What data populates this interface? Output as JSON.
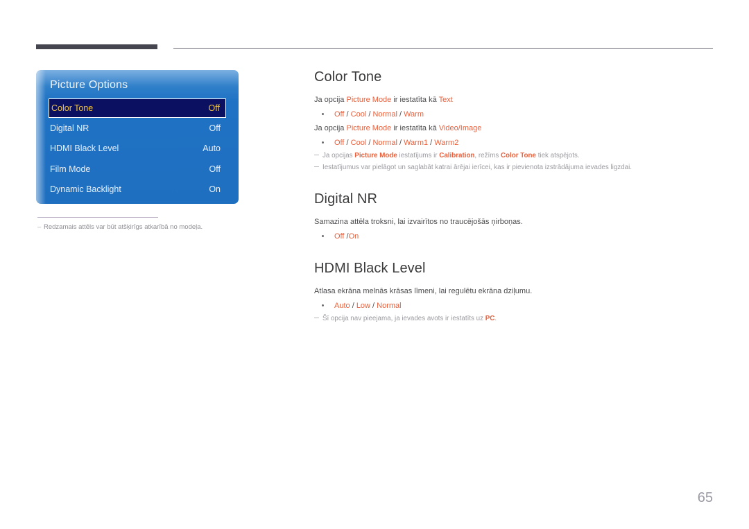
{
  "page": {
    "number": "65",
    "language": "lv"
  },
  "osd": {
    "title": "Picture Options",
    "rows": [
      {
        "label": "Color Tone",
        "value": "Off",
        "selected": true
      },
      {
        "label": "Digital NR",
        "value": "Off",
        "selected": false
      },
      {
        "label": "HDMI Black Level",
        "value": "Auto",
        "selected": false
      },
      {
        "label": "Film Mode",
        "value": "Off",
        "selected": false
      },
      {
        "label": "Dynamic Backlight",
        "value": "On",
        "selected": false
      }
    ],
    "footnote": "Redzamais attēls var būt atšķirīgs atkarībā no modeļa.",
    "footnote_dash": "–"
  },
  "sections": [
    {
      "id": "color-tone",
      "title": "Color Tone",
      "line1": {
        "pre": "Ja opcija ",
        "term": "Picture Mode",
        "mid": " ir iestatīta kā ",
        "mode": "Text"
      },
      "opts1": [
        "Off",
        "Cool",
        "Normal",
        "Warm"
      ],
      "line2": {
        "pre": "Ja opcija ",
        "term": "Picture Mode",
        "mid": " ir iestatīta kā ",
        "mode": "Video/Image"
      },
      "opts2": [
        "Off",
        "Cool",
        "Normal",
        "Warm1",
        "Warm2"
      ],
      "note1": {
        "a": "Ja opcijas ",
        "t1": "Picture Mode",
        "b": " iestatījums ir ",
        "t2": "Calibration",
        "c": ", režīms ",
        "t3": "Color Tone",
        "d": " tiek atspējots."
      },
      "note2": "Iestatījumus var pielāgot un saglabāt katrai ārējai ierīcei, kas ir pievienota izstrādājuma ievades ligzdai."
    },
    {
      "id": "digital-nr",
      "title": "Digital NR",
      "desc": "Samazina attēla troksni, lai izvairītos no traucējošās ņirboņas.",
      "opts": [
        "Off",
        "On"
      ],
      "opts_separator": "/"
    },
    {
      "id": "hdmi-black-level",
      "title": "HDMI Black Level",
      "desc": "Atlasa ekrāna melnās krāsas līmeni, lai regulētu ekrāna dziļumu.",
      "opts": [
        "Auto",
        "Low",
        "Normal"
      ],
      "note": {
        "a": "Šī opcija nav pieejama, ja ievades avots ir iestatīts uz ",
        "t": "PC",
        "b": "."
      }
    }
  ],
  "colors": {
    "accent": "#e8603c",
    "osd_selected_bg": "#0b1060",
    "osd_selected_text": "#f3c53f",
    "osd_blue": "#1f72c4",
    "header_bar": "#45454f",
    "page_number": "#9a9aa4"
  }
}
